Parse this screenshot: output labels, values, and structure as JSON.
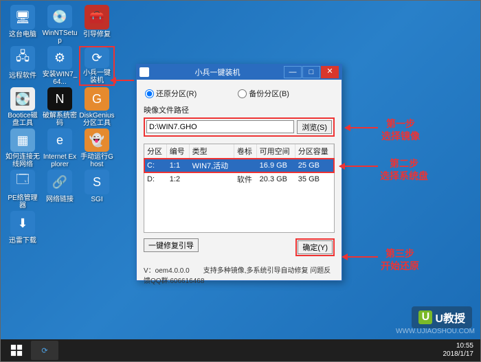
{
  "desktop": {
    "icons": [
      {
        "label": "这台电脑",
        "color": "#2b7ec9",
        "glyph": "🖥"
      },
      {
        "label": "WinNTSetup",
        "color": "#2b7ec9",
        "glyph": "💿"
      },
      {
        "label": "引导修复",
        "color": "#c03028",
        "glyph": "🧰"
      },
      {
        "label": "远程软件",
        "color": "#2b7ec9",
        "glyph": "🖧"
      },
      {
        "label": "安装WIN7_64...",
        "color": "#2b7ec9",
        "glyph": "⚙"
      },
      {
        "label": "小兵一键装机",
        "color": "#2b7ec9",
        "glyph": "⟳",
        "hl": true
      },
      {
        "label": "Bootice磁盘工具",
        "color": "#eeeeee",
        "glyph": "💽",
        "dark": true
      },
      {
        "label": "破解系统密码",
        "color": "#111111",
        "glyph": "N"
      },
      {
        "label": "DiskGenius分区工具",
        "color": "#e58a2e",
        "glyph": "G"
      },
      {
        "label": "如何连接无线网络",
        "color": "#5aa0d8",
        "glyph": "▦"
      },
      {
        "label": "Internet Explorer",
        "color": "#2b7ec9",
        "glyph": "e"
      },
      {
        "label": "手动运行Ghost",
        "color": "#e58a2e",
        "glyph": "👻"
      },
      {
        "label": "PE络管理器",
        "color": "#2b7ec9",
        "glyph": "🗔"
      },
      {
        "label": "网络链接",
        "color": "#2b7ec9",
        "glyph": "🔗"
      },
      {
        "label": "SGI",
        "color": "#2b7ec9",
        "glyph": "S"
      },
      {
        "label": "迅雷下载",
        "color": "#2b7ec9",
        "glyph": "⬇"
      }
    ]
  },
  "window": {
    "title": "小兵一键装机",
    "restore_label": "还原分区(R)",
    "backup_label": "备份分区(B)",
    "path_label": "映像文件路径",
    "path_value": "D:\\WIN7.GHO",
    "browse": "浏览(S)",
    "headers": {
      "p": "分区",
      "n": "编号",
      "t": "类型",
      "v": "卷标",
      "f": "可用空间",
      "c": "分区容量"
    },
    "rows": [
      {
        "p": "C:",
        "n": "1:1",
        "t": "WIN7,活动",
        "v": "",
        "f": "16.9 GB",
        "c": "25 GB",
        "sel": true
      },
      {
        "p": "D:",
        "n": "1:2",
        "t": "",
        "v": "软件",
        "f": "20.3 GB",
        "c": "35 GB"
      }
    ],
    "boot_repair": "一键修复引导",
    "ok": "确定(Y)",
    "status": "V：oem4.0.0.0　　支持多种镜像,多系统引导自动修复 问题反馈QQ群:606616468"
  },
  "steps": {
    "s1a": "第一步",
    "s1b": "选择镜像",
    "s2a": "第二步",
    "s2b": "选择系统盘",
    "s3a": "第三步",
    "s3b": "开始还原"
  },
  "taskbar": {
    "time": "10:55",
    "date": "2018/1/17"
  },
  "brand": {
    "text": "U教授",
    "wm": "WWW.UJIAOSHOU.COM"
  }
}
